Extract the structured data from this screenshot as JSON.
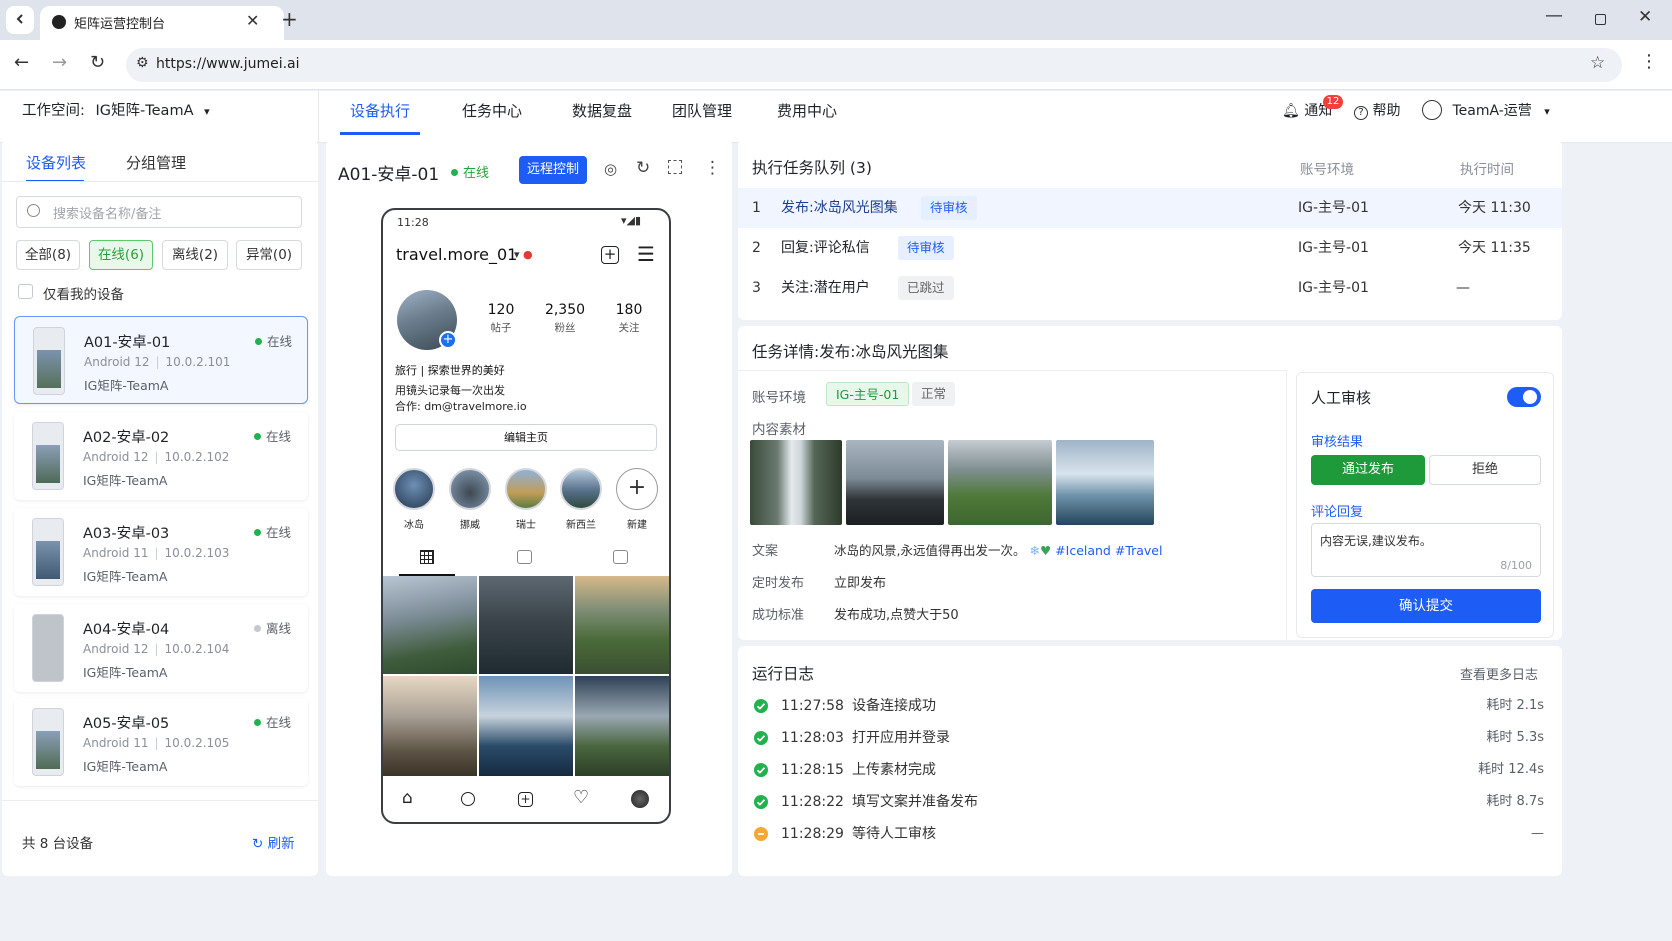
{
  "browser": {
    "tab_title": "矩阵运营控制台",
    "url": "https://www.jumei.ai"
  },
  "header": {
    "workspace_label": "工作空间:",
    "workspace_value": "IG矩阵-TeamA",
    "nav": [
      "设备执行",
      "任务中心",
      "数据复盘",
      "团队管理",
      "费用中心"
    ],
    "notify_label": "通知",
    "notify_badge": "12",
    "help_label": "帮助",
    "user_label": "TeamA-运营"
  },
  "sidebar": {
    "tab_devices": "设备列表",
    "tab_groups": "分组管理",
    "search_placeholder": "搜索设备名称/备注",
    "filters": [
      "全部(8)",
      "在线(6)",
      "离线(2)",
      "异常(0)"
    ],
    "only_mine": "仅看我的设备",
    "devices": [
      {
        "name": "A01-安卓-01",
        "os": "Android 12",
        "ip": "10.0.2.101",
        "team": "IG矩阵-TeamA",
        "status": "在线"
      },
      {
        "name": "A02-安卓-02",
        "os": "Android 12",
        "ip": "10.0.2.102",
        "team": "IG矩阵-TeamA",
        "status": "在线"
      },
      {
        "name": "A03-安卓-03",
        "os": "Android 11",
        "ip": "10.0.2.103",
        "team": "IG矩阵-TeamA",
        "status": "在线"
      },
      {
        "name": "A04-安卓-04",
        "os": "Android 12",
        "ip": "10.0.2.104",
        "team": "IG矩阵-TeamA",
        "status": "离线"
      },
      {
        "name": "A05-安卓-05",
        "os": "Android 11",
        "ip": "10.0.2.105",
        "team": "IG矩阵-TeamA",
        "status": "在线"
      }
    ],
    "total": "共 8 台设备",
    "refresh": "刷新"
  },
  "device_view": {
    "title": "A01-安卓-01",
    "status": "在线",
    "remote_btn": "远程控制",
    "phone": {
      "time": "11:28",
      "username": "travel.more_01",
      "stats": [
        {
          "value": "120",
          "label": "帖子"
        },
        {
          "value": "2,350",
          "label": "粉丝"
        },
        {
          "value": "180",
          "label": "关注"
        }
      ],
      "bio1": "旅行 | 探索世界的美好",
      "bio2": "用镜头记录每一次出发",
      "bio3": "合作:  dm@travelmore.io",
      "edit_btn": "编辑主页",
      "highlights": [
        "冰岛",
        "挪威",
        "瑞士",
        "新西兰",
        "新建"
      ]
    }
  },
  "queue": {
    "title": "执行任务队列 (3)",
    "col_account": "账号环境",
    "col_time": "执行时间",
    "rows": [
      {
        "idx": "1",
        "task": "发布:冰岛风光图集",
        "status": "待审核",
        "account": "IG-主号-01",
        "time": "今天 11:30"
      },
      {
        "idx": "2",
        "task": "回复:评论私信",
        "status": "待审核",
        "account": "IG-主号-01",
        "time": "今天 11:35"
      },
      {
        "idx": "3",
        "task": "关注:潜在用户",
        "status": "已跳过",
        "account": "IG-主号-01",
        "time": "—"
      }
    ]
  },
  "detail": {
    "title": "任务详情:发布:冰岛风光图集",
    "account_label": "账号环境",
    "account_tag": "IG-主号-01",
    "account_state": "正常",
    "material_label": "内容素材",
    "copy_label": "文案",
    "copy_text": "冰岛的风景,永远值得再出发一次。",
    "copy_tags": "#Iceland #Travel",
    "schedule_label": "定时发布",
    "schedule_value": "立即发布",
    "success_label": "成功标准",
    "success_value": "发布成功,点赞大于50"
  },
  "review": {
    "title": "人工审核",
    "result_label": "审核结果",
    "approve": "通过发布",
    "reject": "拒绝",
    "comment_label": "评论回复",
    "comment_value": "内容无误,建议发布。",
    "counter": "8/100",
    "submit": "确认提交"
  },
  "logs": {
    "title": "运行日志",
    "more": "查看更多日志",
    "rows": [
      {
        "time": "11:27:58",
        "text": "设备连接成功",
        "cost": "耗时  2.1s",
        "state": "ok"
      },
      {
        "time": "11:28:03",
        "text": "打开应用并登录",
        "cost": "耗时  5.3s",
        "state": "ok"
      },
      {
        "time": "11:28:15",
        "text": "上传素材完成",
        "cost": "耗时  12.4s",
        "state": "ok"
      },
      {
        "time": "11:28:22",
        "text": "填写文案并准备发布",
        "cost": "耗时  8.7s",
        "state": "ok"
      },
      {
        "time": "11:28:29",
        "text": "等待人工审核",
        "cost": "—",
        "state": "wait"
      }
    ]
  },
  "colors": {
    "accent": "#1d5cf5",
    "success": "#22b14c",
    "approve": "#1f9a3a",
    "warning": "#f7a737"
  }
}
